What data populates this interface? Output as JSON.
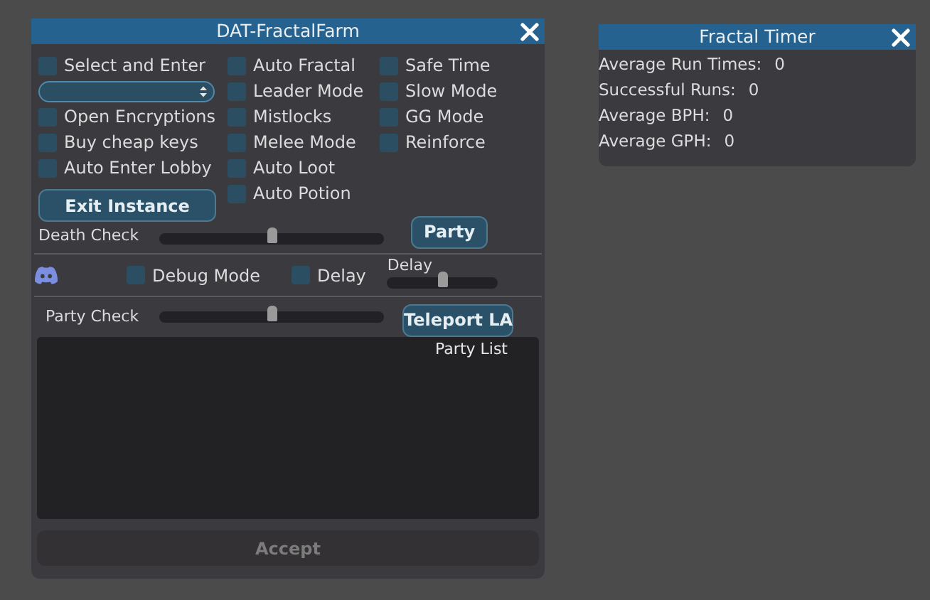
{
  "main_window": {
    "title": "DAT-FractalFarm",
    "columns": [
      [
        {
          "kind": "checkbox",
          "label": "Select and Enter",
          "checked": false
        },
        {
          "kind": "dropdown"
        },
        {
          "kind": "checkbox",
          "label": "Open Encryptions",
          "checked": false
        },
        {
          "kind": "checkbox",
          "label": "Buy cheap keys",
          "checked": false
        },
        {
          "kind": "checkbox",
          "label": "Auto Enter Lobby",
          "checked": false
        },
        {
          "kind": "button",
          "label": "Exit Instance"
        }
      ],
      [
        {
          "kind": "checkbox",
          "label": "Auto Fractal",
          "checked": false
        },
        {
          "kind": "checkbox",
          "label": "Leader Mode",
          "checked": false
        },
        {
          "kind": "checkbox",
          "label": "Mistlocks",
          "checked": false
        },
        {
          "kind": "checkbox",
          "label": "Melee Mode",
          "checked": false
        },
        {
          "kind": "checkbox",
          "label": "Auto Loot",
          "checked": false
        },
        {
          "kind": "checkbox",
          "label": "Auto Potion",
          "checked": false
        }
      ],
      [
        {
          "kind": "checkbox",
          "label": "Safe Time",
          "checked": false
        },
        {
          "kind": "checkbox",
          "label": "Slow Mode",
          "checked": false
        },
        {
          "kind": "checkbox",
          "label": "GG Mode",
          "checked": false
        },
        {
          "kind": "checkbox",
          "label": "Reinforce",
          "checked": false
        }
      ]
    ],
    "death_check": {
      "label": "Death Check",
      "level": 0.5
    },
    "party_button": "Party",
    "debug_mode": {
      "label": "Debug Mode",
      "checked": false
    },
    "delay_checkbox": {
      "label": "Delay",
      "checked": false
    },
    "delay_slider": {
      "label": "Delay",
      "level": 0.5
    },
    "party_check": {
      "label": "Party Check",
      "level": 0.5
    },
    "teleport_button": "Teleport LA",
    "party_list": {
      "label": "Party List"
    },
    "accept_button": {
      "label": "Accept",
      "disabled": true
    }
  },
  "timer_window": {
    "title": "Fractal Timer",
    "stats": [
      {
        "label": "Average Run Times:",
        "value": "0"
      },
      {
        "label": "Successful Runs:",
        "value": "0"
      },
      {
        "label": "Average BPH:",
        "value": "0"
      },
      {
        "label": "Average GPH:",
        "value": "0"
      }
    ]
  }
}
